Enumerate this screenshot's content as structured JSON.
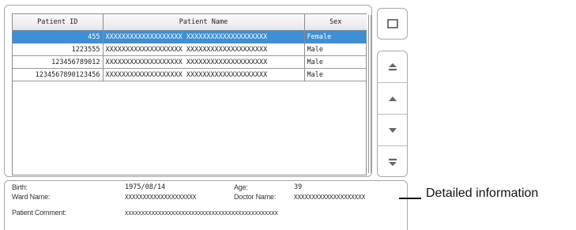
{
  "table": {
    "columns": [
      "Patient ID",
      "Patient Name",
      "Sex"
    ],
    "rows": [
      {
        "id": "455",
        "name": "XXXXXXXXXXXXXXXXXXX XXXXXXXXXXXXXXXXXXXX",
        "sex": "Female",
        "selected": true
      },
      {
        "id": "1223555",
        "name": "XXXXXXXXXXXXXXXXXXX XXXXXXXXXXXXXXXXXXXX",
        "sex": "Male",
        "selected": false
      },
      {
        "id": "123456789012",
        "name": "XXXXXXXXXXXXXXXXXXX XXXXXXXXXXXXXXXXXXXX",
        "sex": "Male",
        "selected": false
      },
      {
        "id": "1234567890123456",
        "name": "XXXXXXXXXXXXXXXXXXX XXXXXXXXXXXXXXXXXXXX",
        "sex": "Male",
        "selected": false
      }
    ]
  },
  "buttons": {
    "detail_icon": "square-icon",
    "scroll": [
      "scroll-top-icon",
      "scroll-up-icon",
      "scroll-down-icon",
      "scroll-bottom-icon"
    ]
  },
  "detail": {
    "birth_label": "Birth:",
    "birth_value": "1975/08/14",
    "age_label": "Age:",
    "age_value": "39",
    "ward_label": "Ward Name:",
    "ward_value": "XXXXXXXXXXXXXXXXXXXX",
    "doctor_label": "Doctor Name:",
    "doctor_value": "XXXXXXXXXXXXXXXXXXXX",
    "comment_label": "Patient Comment:",
    "comment_value": "XXXXXXXXXXXXXXXXXXXXXXXXXXXXXXXXXXXXXXXXXXXXXX"
  },
  "callout": {
    "text": "Detailed information"
  },
  "colors": {
    "selection": "#3d8fd6",
    "border": "#a8a8a8",
    "icon": "#666666"
  }
}
